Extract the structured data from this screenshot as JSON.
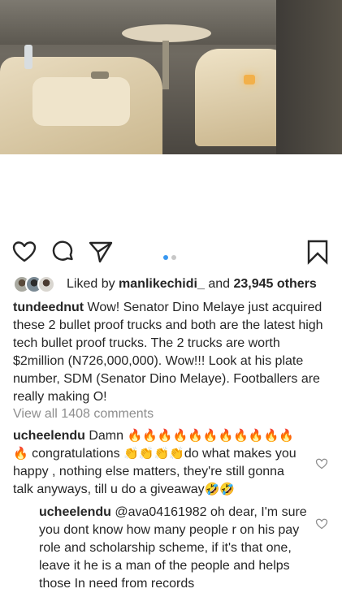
{
  "post": {
    "image_alt": "",
    "carousel": {
      "count": 2,
      "active": 0,
      "active_color": "#3897f0",
      "inactive_color": "#c7c7c7"
    }
  },
  "actions": {
    "like_icon": "heart-outline-icon",
    "comment_icon": "comment-bubble-icon",
    "share_icon": "paper-plane-icon",
    "save_icon": "bookmark-icon"
  },
  "likes": {
    "prefix": "Liked by ",
    "user": "manlikechidi_",
    "and": " and ",
    "count": "23,945 others"
  },
  "caption": {
    "username": "tundeednut",
    "text": " Wow! Senator Dino Melaye just acquired these 2 bullet proof trucks and both are the latest high tech bullet proof trucks. The 2 trucks are worth $2million (N726,000,000). Wow!!! Look at his plate number, SDM (Senator Dino Melaye). Footballers are really making O!"
  },
  "view_all": "View all 1408 comments",
  "comments": [
    {
      "username": "ucheelendu",
      "text_a": " Damn ",
      "emojis_a": "🔥🔥🔥🔥🔥🔥🔥🔥🔥🔥🔥🔥",
      "text_b": " congratulations ",
      "emojis_b": "👏👏👏👏",
      "text_c": "do what makes you happy , nothing else matters, they're still gonna talk anyways, till u do a giveaway",
      "emojis_c": "🤣🤣"
    },
    {
      "username": "ucheelendu",
      "mention": " @ava04161982",
      "text": " oh dear, I'm sure you dont know how many people r on his pay role and scholarship scheme, if it's that one, leave it he is a man of the people and helps those In need from records"
    }
  ],
  "colors": {
    "text": "#262626",
    "muted": "#8e8e8e",
    "accent": "#3897f0"
  }
}
